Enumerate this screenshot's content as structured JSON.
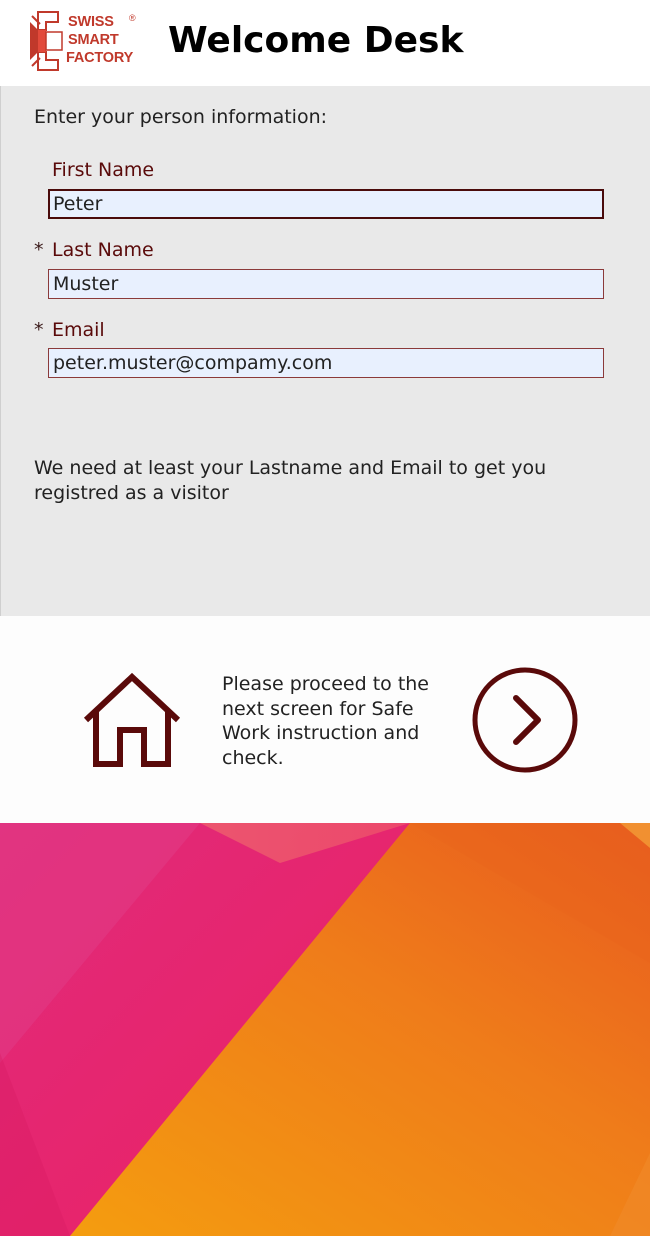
{
  "header": {
    "logo": {
      "line1": "SWISS",
      "line2": "SMART",
      "line3": "FACTORY",
      "registered": "®"
    },
    "title": "Welcome Desk"
  },
  "form": {
    "intro": "Enter your person information:",
    "first_name": {
      "label": "First Name",
      "required_mark": "",
      "value": "Peter"
    },
    "last_name": {
      "label": "Last Name",
      "required_mark": "*",
      "value": "Muster"
    },
    "email": {
      "label": "Email",
      "required_mark": "*",
      "value": "peter.muster@compamy.com"
    },
    "hint": "We need at least your Lastname and Email to get you registred as a visitor"
  },
  "navigation": {
    "home_icon": "home-icon",
    "proceed_text": "Please proceed to the next screen for Safe Work instruction and check.",
    "next_icon": "chevron-right-circle-icon"
  },
  "colors": {
    "brand_red": "#c0392b",
    "accent_dark_red": "#5a0a0a",
    "panel_gray": "#e9e9e9",
    "input_bg": "#e8f0fe",
    "gradient_pink": "#e91e63",
    "gradient_orange": "#f39c12"
  }
}
